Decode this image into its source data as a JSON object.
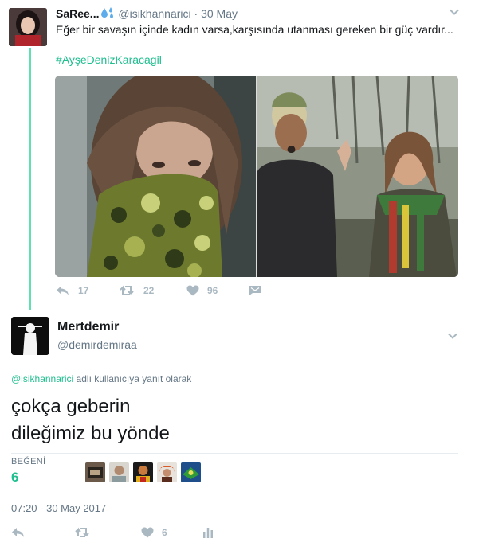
{
  "parent_tweet": {
    "name": "SaRee...",
    "handle": "@isikhannarici",
    "separator": "·",
    "date": "30 May",
    "text": "Eğer bir savaşın içinde kadın varsa,karşısında utanması gereken bir güç vardır...",
    "hashtag": "#AyşeDenizKaracagil",
    "actions": {
      "reply_count": "17",
      "retweet_count": "22",
      "like_count": "96"
    }
  },
  "focused_tweet": {
    "author_name": "Mertdemir",
    "author_handle": "@demirdemiraa",
    "replying_mention": "@isikhannarici",
    "replying_suffix": " adlı kullanıcıya yanıt olarak",
    "text_line1": "çokça geberin",
    "text_line2": "dileğimiz bu yönde",
    "likes_label": "BEĞENİ",
    "likes_count": "6",
    "timestamp": "07:20 - 30 May 2017",
    "actions": {
      "like_count": "6"
    }
  },
  "colors": {
    "accent": "#1fbf8f",
    "thread_line": "#5ee0b1",
    "muted": "#657786",
    "action_icons": "#aab8c2"
  },
  "icons": [
    "droplet-emoji-icon",
    "chevron-down-icon",
    "reply-icon",
    "retweet-icon",
    "heart-icon",
    "direct-message-icon",
    "analytics-icon"
  ]
}
